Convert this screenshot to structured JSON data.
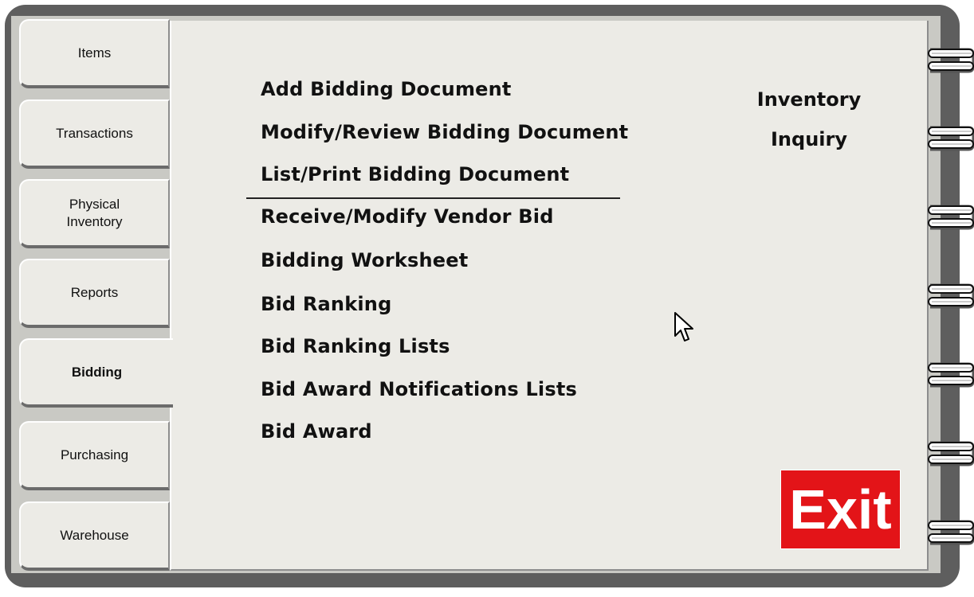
{
  "tabs": [
    {
      "label": "Items"
    },
    {
      "label": "Transactions"
    },
    {
      "label": "Physical\nInventory"
    },
    {
      "label": "Reports"
    },
    {
      "label": "Bidding"
    },
    {
      "label": "Purchasing"
    },
    {
      "label": "Warehouse"
    }
  ],
  "active_tab": "Bidding",
  "menu": {
    "top": [
      "Add Bidding Document",
      "Modify/Review Bidding Document",
      "List/Print Bidding Document"
    ],
    "bottom": [
      "Receive/Modify Vendor Bid",
      "Bidding Worksheet",
      "Bid Ranking",
      "Bid Ranking Lists",
      "Bid Award Notifications Lists",
      "Bid Award"
    ]
  },
  "inquiry": {
    "label": "Inventory\nInquiry"
  },
  "exit": {
    "label": "Exit",
    "color": "#e31418"
  },
  "icons": {
    "rings": "spiral-binding-ring-icon",
    "cursor": "mouse-pointer-icon"
  }
}
